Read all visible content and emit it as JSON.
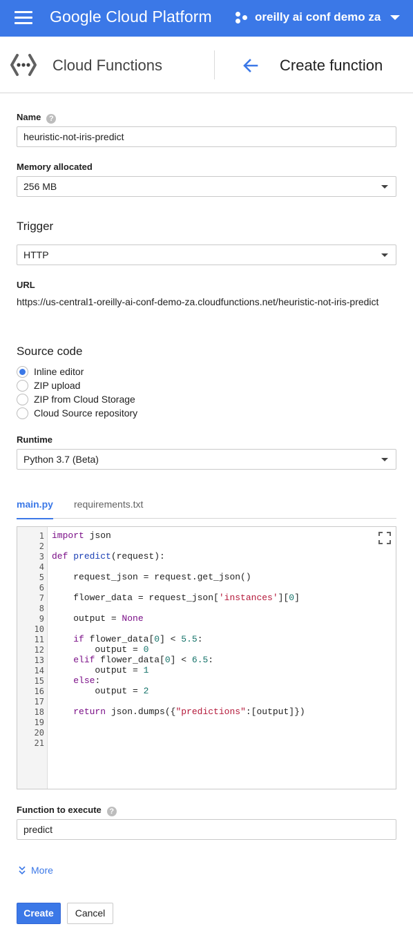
{
  "appbar": {
    "title": "Google Cloud Platform",
    "project": "oreilly ai conf demo za"
  },
  "subheader": {
    "service": "Cloud Functions",
    "page_title": "Create function"
  },
  "form": {
    "name": {
      "label": "Name",
      "value": "heuristic-not-iris-predict"
    },
    "memory": {
      "label": "Memory allocated",
      "value": "256 MB"
    },
    "trigger": {
      "title": "Trigger",
      "value": "HTTP"
    },
    "url": {
      "label": "URL",
      "value": "https://us-central1-oreilly-ai-conf-demo-za.cloudfunctions.net/heuristic-not-iris-predict"
    },
    "source": {
      "title": "Source code",
      "options": [
        "Inline editor",
        "ZIP upload",
        "ZIP from Cloud Storage",
        "Cloud Source repository"
      ],
      "selected": "Inline editor"
    },
    "runtime": {
      "label": "Runtime",
      "value": "Python 3.7 (Beta)"
    },
    "tabs": [
      "main.py",
      "requirements.txt"
    ],
    "active_tab": "main.py",
    "code_lines": [
      "import json",
      "",
      "def predict(request):",
      "",
      "    request_json = request.get_json()",
      "",
      "    flower_data = request_json['instances'][0]",
      "",
      "    output = None",
      "",
      "    if flower_data[0] < 5.5:",
      "        output = 0",
      "    elif flower_data[0] < 6.5:",
      "        output = 1",
      "    else:",
      "        output = 2",
      "",
      "    return json.dumps({\"predictions\":[output]})",
      "",
      "",
      ""
    ],
    "function": {
      "label": "Function to execute",
      "value": "predict"
    },
    "more_label": "More",
    "create_label": "Create",
    "cancel_label": "Cancel"
  },
  "colors": {
    "brand": "#3b78e7",
    "keyword": "#7a0e87",
    "string": "#b4193a",
    "number": "#15736a"
  }
}
